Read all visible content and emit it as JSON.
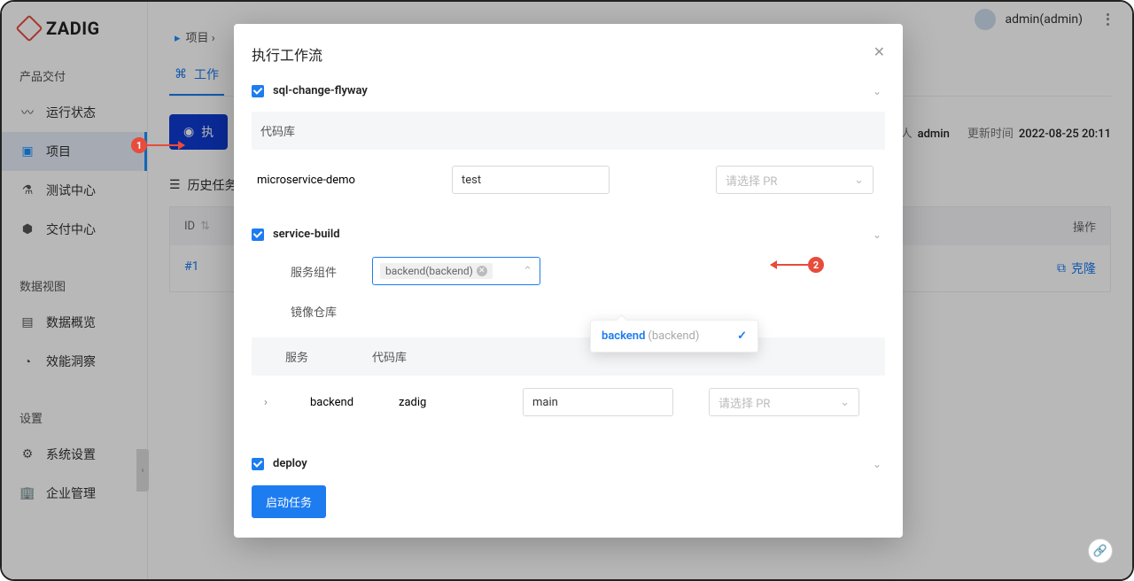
{
  "brand": "ZADIG",
  "breadcrumb_label": "项目",
  "user": {
    "name": "admin(admin)"
  },
  "sidebar": {
    "groups": [
      {
        "title": "产品交付",
        "items": [
          {
            "label": "运行状态",
            "icon": "activity-icon"
          },
          {
            "label": "项目",
            "icon": "project-icon",
            "active": true
          },
          {
            "label": "测试中心",
            "icon": "flask-icon"
          },
          {
            "label": "交付中心",
            "icon": "package-icon"
          }
        ]
      },
      {
        "title": "数据视图",
        "items": [
          {
            "label": "数据概览",
            "icon": "monitor-icon"
          },
          {
            "label": "效能洞察",
            "icon": "pie-icon"
          }
        ]
      },
      {
        "title": "设置",
        "items": [
          {
            "label": "系统设置",
            "icon": "gear-icon"
          },
          {
            "label": "企业管理",
            "icon": "building-icon"
          }
        ]
      }
    ]
  },
  "tab": {
    "label": "工作"
  },
  "exec_button": "执",
  "meta": {
    "updater_label": "人",
    "updater": "admin",
    "time_label": "更新时间",
    "time": "2022-08-25 20:11"
  },
  "history": {
    "title": "历史任务",
    "col_id": "ID",
    "col_op": "操作",
    "row_id": "#1",
    "row_op": "克隆"
  },
  "modal": {
    "title": "执行工作流",
    "steps": [
      {
        "name": "sql-change-flyway"
      },
      {
        "name": "service-build"
      },
      {
        "name": "deploy"
      }
    ],
    "code_repo_label": "代码库",
    "repo1": {
      "name": "microservice-demo",
      "branch": "test",
      "pr_placeholder": "请选择 PR"
    },
    "svc_comp_label": "服务组件",
    "svc_tag": "backend(backend)",
    "img_repo_label": "镜像仓库",
    "dropdown": {
      "main": "backend",
      "sub": "(backend)"
    },
    "svc_table": {
      "hdr1": "服务",
      "hdr2": "代码库",
      "svc": "backend",
      "repo": "zadig",
      "branch": "main",
      "pr_placeholder": "请选择 PR"
    },
    "start": "启动任务"
  },
  "annot": {
    "one": "1",
    "two": "2"
  }
}
